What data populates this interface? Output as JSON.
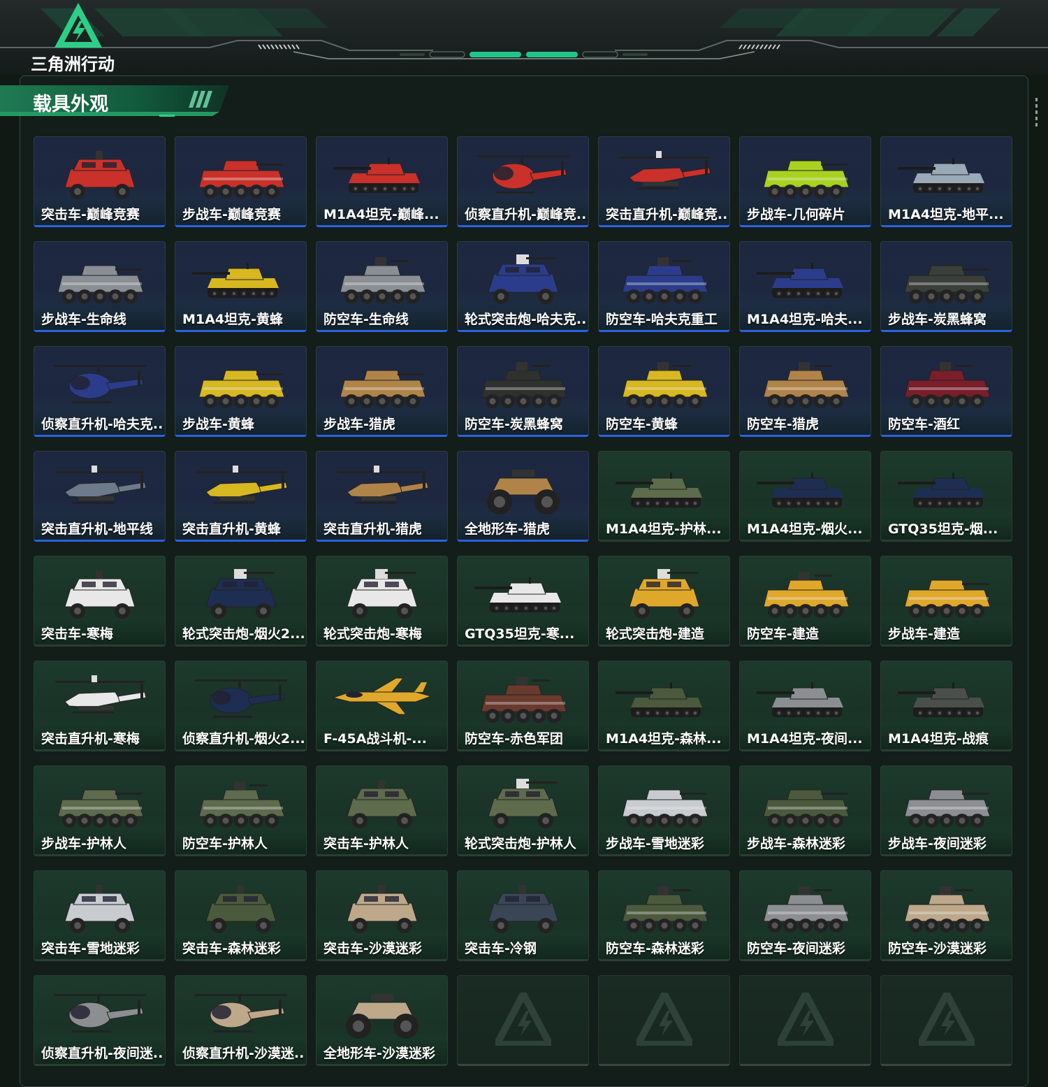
{
  "app": {
    "logo_text": "三角洲行动",
    "accent_color": "#2bd088",
    "rare_color": "#2a62e0"
  },
  "section": {
    "title": "载具外观"
  },
  "skins": [
    {
      "name": "突击车-巅峰竞赛",
      "rarity": "blue",
      "icon": "assault-car-icon",
      "livery": "#c9312a"
    },
    {
      "name": "步战车-巅峰竞赛",
      "rarity": "blue",
      "icon": "ifv-icon",
      "livery": "#c9312a"
    },
    {
      "name": "M1A4坦克-巅峰...",
      "rarity": "blue",
      "icon": "tank-icon",
      "livery": "#c9312a"
    },
    {
      "name": "侦察直升机-巅峰竞...",
      "rarity": "blue",
      "icon": "scout-helicopter-icon",
      "livery": "#c9312a"
    },
    {
      "name": "突击直升机-巅峰竞...",
      "rarity": "blue",
      "icon": "attack-helicopter-icon",
      "livery": "#c9312a"
    },
    {
      "name": "步战车-几何碎片",
      "rarity": "blue",
      "icon": "ifv-icon",
      "livery": "#a9d21f"
    },
    {
      "name": "M1A4坦克-地平...",
      "rarity": "blue",
      "icon": "tank-icon",
      "livery": "#9aa9b8"
    },
    {
      "name": "步战车-生命线",
      "rarity": "blue",
      "icon": "ifv-icon",
      "livery": "#8a8f96"
    },
    {
      "name": "M1A4坦克-黄蜂",
      "rarity": "blue",
      "icon": "tank-icon",
      "livery": "#d8b820"
    },
    {
      "name": "防空车-生命线",
      "rarity": "blue",
      "icon": "aa-vehicle-icon",
      "livery": "#8a8f96"
    },
    {
      "name": "轮式突击炮-哈夫克...",
      "rarity": "blue",
      "icon": "wheeled-gun-icon",
      "livery": "#2c3c8c"
    },
    {
      "name": "防空车-哈夫克重工",
      "rarity": "blue",
      "icon": "aa-vehicle-icon",
      "livery": "#2c3c8c"
    },
    {
      "name": "M1A4坦克-哈夫...",
      "rarity": "blue",
      "icon": "tank-icon",
      "livery": "#2c3c8c"
    },
    {
      "name": "步战车-炭黑蜂窝",
      "rarity": "blue",
      "icon": "ifv-icon",
      "livery": "#3b3f3a"
    },
    {
      "name": "侦察直升机-哈夫克...",
      "rarity": "blue",
      "icon": "scout-helicopter-icon",
      "livery": "#2c3c8c"
    },
    {
      "name": "步战车-黄蜂",
      "rarity": "blue",
      "icon": "ifv-icon",
      "livery": "#d8b820"
    },
    {
      "name": "步战车-猎虎",
      "rarity": "blue",
      "icon": "ifv-icon",
      "livery": "#b08448"
    },
    {
      "name": "防空车-炭黑蜂窝",
      "rarity": "blue",
      "icon": "aa-vehicle-icon",
      "livery": "#2f312e"
    },
    {
      "name": "防空车-黄蜂",
      "rarity": "blue",
      "icon": "aa-vehicle-icon",
      "livery": "#d8b820"
    },
    {
      "name": "防空车-猎虎",
      "rarity": "blue",
      "icon": "aa-vehicle-icon",
      "livery": "#b08448"
    },
    {
      "name": "防空车-酒红",
      "rarity": "blue",
      "icon": "aa-vehicle-icon",
      "livery": "#7a1e2a"
    },
    {
      "name": "突击直升机-地平线",
      "rarity": "blue",
      "icon": "attack-helicopter-icon",
      "livery": "#6c7a8a"
    },
    {
      "name": "突击直升机-黄蜂",
      "rarity": "blue",
      "icon": "attack-helicopter-icon",
      "livery": "#d8b820"
    },
    {
      "name": "突击直升机-猎虎",
      "rarity": "blue",
      "icon": "attack-helicopter-icon",
      "livery": "#b08448"
    },
    {
      "name": "全地形车-猎虎",
      "rarity": "blue",
      "icon": "atv-icon",
      "livery": "#b08448"
    },
    {
      "name": "M1A4坦克-护林...",
      "rarity": "green",
      "icon": "tank-icon",
      "livery": "#5e6b4c"
    },
    {
      "name": "M1A4坦克-烟火...",
      "rarity": "green",
      "icon": "tank-icon",
      "livery": "#1e2e52"
    },
    {
      "name": "GTQ35坦克-烟...",
      "rarity": "green",
      "icon": "tank-icon",
      "livery": "#1e2e52"
    },
    {
      "name": "突击车-寒梅",
      "rarity": "green",
      "icon": "assault-car-icon",
      "livery": "#e8e8e8"
    },
    {
      "name": "轮式突击炮-烟火2...",
      "rarity": "green",
      "icon": "wheeled-gun-icon",
      "livery": "#1e2e52"
    },
    {
      "name": "轮式突击炮-寒梅",
      "rarity": "green",
      "icon": "wheeled-gun-icon",
      "livery": "#e8e8e8"
    },
    {
      "name": "GTQ35坦克-寒...",
      "rarity": "green",
      "icon": "tank-icon",
      "livery": "#e8e8e8"
    },
    {
      "name": "轮式突击炮-建造",
      "rarity": "green",
      "icon": "wheeled-gun-icon",
      "livery": "#e0a82a"
    },
    {
      "name": "防空车-建造",
      "rarity": "green",
      "icon": "aa-vehicle-icon",
      "livery": "#e0a82a"
    },
    {
      "name": "步战车-建造",
      "rarity": "green",
      "icon": "ifv-icon",
      "livery": "#e0a82a"
    },
    {
      "name": "突击直升机-寒梅",
      "rarity": "green",
      "icon": "attack-helicopter-icon",
      "livery": "#e8e8e8"
    },
    {
      "name": "侦察直升机-烟火2...",
      "rarity": "green",
      "icon": "scout-helicopter-icon",
      "livery": "#1e2e52"
    },
    {
      "name": "F-45A战斗机-...",
      "rarity": "green",
      "icon": "fighter-jet-icon",
      "livery": "#e0a82a"
    },
    {
      "name": "防空车-赤色军团",
      "rarity": "green",
      "icon": "aa-vehicle-icon",
      "livery": "#6a3a2e"
    },
    {
      "name": "M1A4坦克-森林...",
      "rarity": "green",
      "icon": "tank-icon",
      "livery": "#4b5a3c"
    },
    {
      "name": "M1A4坦克-夜间...",
      "rarity": "green",
      "icon": "tank-icon",
      "livery": "#8c8f92"
    },
    {
      "name": "M1A4坦克-战痕",
      "rarity": "green",
      "icon": "tank-icon",
      "livery": "#4a4f4c"
    },
    {
      "name": "步战车-护林人",
      "rarity": "green",
      "icon": "ifv-icon",
      "livery": "#5e6b4c"
    },
    {
      "name": "防空车-护林人",
      "rarity": "green",
      "icon": "aa-vehicle-icon",
      "livery": "#5e6b4c"
    },
    {
      "name": "突击车-护林人",
      "rarity": "green",
      "icon": "assault-car-icon",
      "livery": "#5e6b4c"
    },
    {
      "name": "轮式突击炮-护林人",
      "rarity": "green",
      "icon": "wheeled-gun-icon",
      "livery": "#5e6b4c"
    },
    {
      "name": "步战车-雪地迷彩",
      "rarity": "green",
      "icon": "ifv-icon",
      "livery": "#c8ccd0"
    },
    {
      "name": "步战车-森林迷彩",
      "rarity": "green",
      "icon": "ifv-icon",
      "livery": "#4b5a3c"
    },
    {
      "name": "步战车-夜间迷彩",
      "rarity": "green",
      "icon": "ifv-icon",
      "livery": "#8c8f92"
    },
    {
      "name": "突击车-雪地迷彩",
      "rarity": "green",
      "icon": "assault-car-icon",
      "livery": "#c8ccd0"
    },
    {
      "name": "突击车-森林迷彩",
      "rarity": "green",
      "icon": "assault-car-icon",
      "livery": "#4b5a3c"
    },
    {
      "name": "突击车-沙漠迷彩",
      "rarity": "green",
      "icon": "assault-car-icon",
      "livery": "#bda88a"
    },
    {
      "name": "突击车-冷钢",
      "rarity": "green",
      "icon": "assault-car-icon",
      "livery": "#3a4656"
    },
    {
      "name": "防空车-森林迷彩",
      "rarity": "green",
      "icon": "aa-vehicle-icon",
      "livery": "#4b5a3c"
    },
    {
      "name": "防空车-夜间迷彩",
      "rarity": "green",
      "icon": "aa-vehicle-icon",
      "livery": "#8c8f92"
    },
    {
      "name": "防空车-沙漠迷彩",
      "rarity": "green",
      "icon": "aa-vehicle-icon",
      "livery": "#bda88a"
    },
    {
      "name": "侦察直升机-夜间迷...",
      "rarity": "green",
      "icon": "scout-helicopter-icon",
      "livery": "#8c8f92"
    },
    {
      "name": "侦察直升机-沙漠迷...",
      "rarity": "green",
      "icon": "scout-helicopter-icon",
      "livery": "#bda88a"
    },
    {
      "name": "全地形车-沙漠迷彩",
      "rarity": "green",
      "icon": "atv-icon",
      "livery": "#bda88a"
    },
    {
      "name": "",
      "rarity": "empty",
      "icon": "delta-emblem-icon"
    },
    {
      "name": "",
      "rarity": "empty",
      "icon": "delta-emblem-icon"
    },
    {
      "name": "",
      "rarity": "empty",
      "icon": "delta-emblem-icon"
    },
    {
      "name": "",
      "rarity": "empty",
      "icon": "delta-emblem-icon"
    }
  ]
}
